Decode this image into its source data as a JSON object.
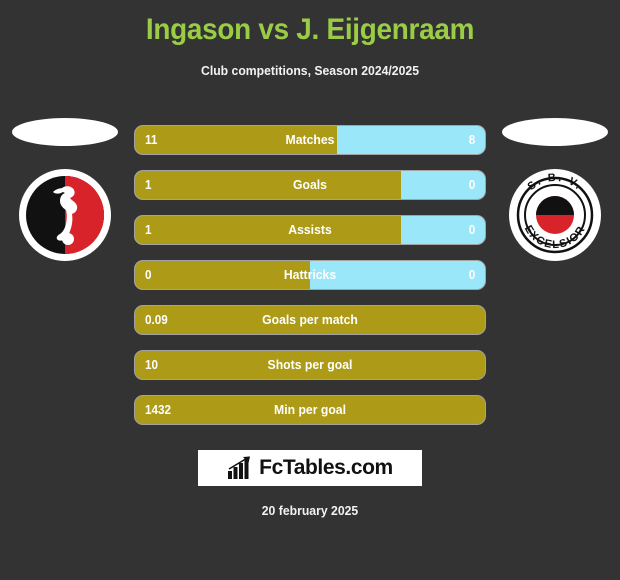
{
  "header": {
    "title": "Ingason vs J. Eijgenraam",
    "subtitle": "Club competitions, Season 2024/2025"
  },
  "teams": {
    "home": {
      "logo_name": "valur-crest-icon"
    },
    "away": {
      "logo_name": "sbv-excelsior-crest-icon",
      "logo_text_top": "S. B. V.",
      "logo_text_bottom": "EXCELSIOR"
    }
  },
  "stats": [
    {
      "label": "Matches",
      "home": "11",
      "away": "8",
      "home_pct": 57.8,
      "two_sided": true
    },
    {
      "label": "Goals",
      "home": "1",
      "away": "0",
      "home_pct": 76.0,
      "two_sided": true
    },
    {
      "label": "Assists",
      "home": "1",
      "away": "0",
      "home_pct": 76.0,
      "two_sided": true
    },
    {
      "label": "Hattricks",
      "home": "0",
      "away": "0",
      "home_pct": 50.0,
      "two_sided": true
    },
    {
      "label": "Goals per match",
      "home": "0.09",
      "away": "",
      "home_pct": 100,
      "two_sided": false
    },
    {
      "label": "Shots per goal",
      "home": "10",
      "away": "",
      "home_pct": 100,
      "two_sided": false
    },
    {
      "label": "Min per goal",
      "home": "1432",
      "away": "",
      "home_pct": 100,
      "two_sided": false
    }
  ],
  "footer": {
    "brand": "FcTables.com",
    "brand_icon": "bar-chart-growth-icon",
    "date": "20 february 2025"
  },
  "colors": {
    "background": "#333333",
    "title": "#9ACD45",
    "home_bar": "#AD9A16",
    "away_bar": "#9BE7FA",
    "text": "#ffffff"
  }
}
